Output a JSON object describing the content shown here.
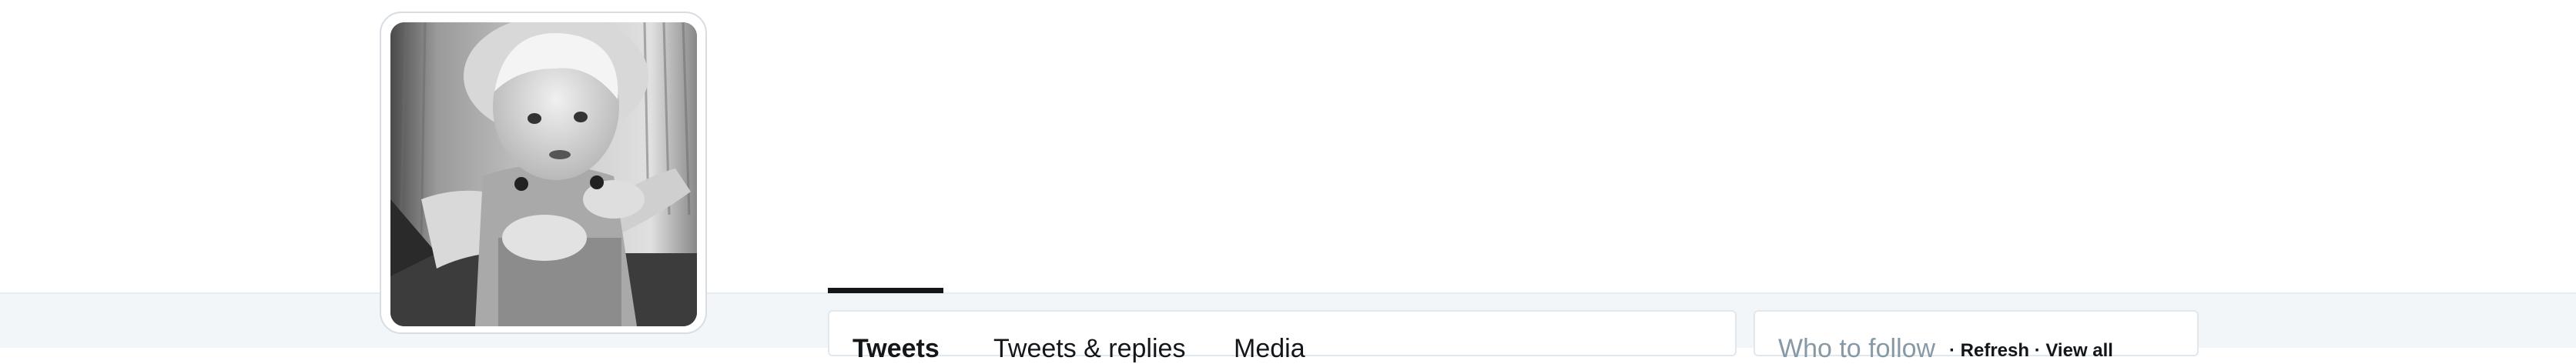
{
  "profile": {
    "avatar_icon": "profile-photo-child"
  },
  "tabs": [
    {
      "label": "Tweets",
      "active": true
    },
    {
      "label": "Tweets & replies",
      "active": false
    },
    {
      "label": "Media",
      "active": false
    }
  ],
  "sidebar": {
    "who_to_follow_title": "Who to follow",
    "refresh_label": "· Refresh · View all"
  },
  "colors": {
    "accent": "#14171a",
    "band_background": "#f3f6f8",
    "border": "#e1e8ed",
    "muted_text": "#8899a6"
  }
}
